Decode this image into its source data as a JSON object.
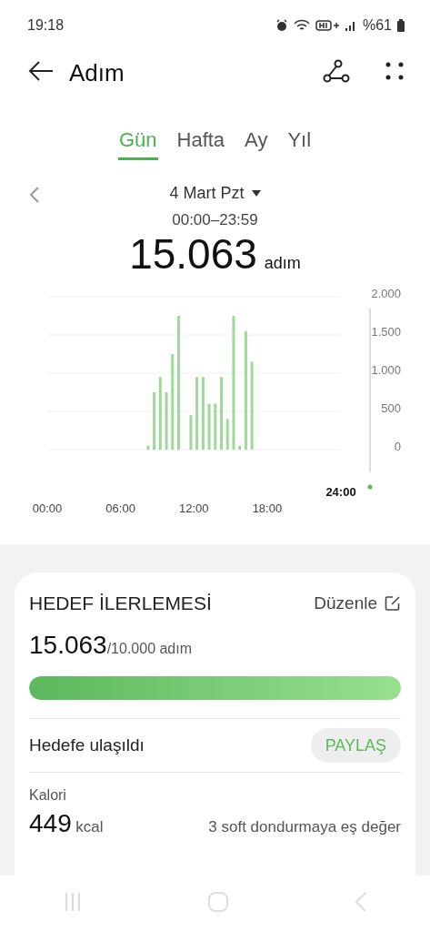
{
  "status_bar": {
    "time": "19:18",
    "battery": "%61"
  },
  "header": {
    "title": "Adım"
  },
  "tabs": [
    {
      "label": "Gün",
      "selected": true
    },
    {
      "label": "Hafta",
      "selected": false
    },
    {
      "label": "Ay",
      "selected": false
    },
    {
      "label": "Yıl",
      "selected": false
    }
  ],
  "date_nav": {
    "date": "4 Mart Pzt",
    "range": "00:00–23:59",
    "steps": "15.063",
    "unit": "adım"
  },
  "chart": {
    "marker_label": "24:00",
    "chart_data": {
      "type": "bar",
      "x": [
        8.25,
        8.75,
        9.25,
        9.75,
        10.25,
        10.75,
        11.25,
        11.75,
        12.25,
        12.75,
        13.25,
        13.75,
        14.25,
        14.75,
        15.25,
        15.75,
        16.25,
        16.75
      ],
      "values": [
        50,
        750,
        950,
        750,
        1250,
        1750,
        0,
        450,
        950,
        950,
        600,
        600,
        950,
        400,
        1750,
        50,
        1550,
        1150
      ],
      "xlim": [
        0,
        24
      ],
      "ylim": [
        0,
        2000
      ],
      "grid": true,
      "xticks": [
        {
          "value": 0,
          "label": "00:00"
        },
        {
          "value": 6,
          "label": "06:00"
        },
        {
          "value": 12,
          "label": "12:00"
        },
        {
          "value": 18,
          "label": "18:00"
        }
      ],
      "yticks": [
        {
          "value": 0,
          "label": "0"
        },
        {
          "value": 500,
          "label": "500"
        },
        {
          "value": 1000,
          "label": "1.000"
        },
        {
          "value": 1500,
          "label": "1.500"
        },
        {
          "value": 2000,
          "label": "2.000"
        }
      ]
    }
  },
  "goal": {
    "title": "HEDEF İLERLEMESİ",
    "edit": "Düzenle",
    "value": "15.063",
    "target": "/10.000 adım",
    "level": 1,
    "status": "Hedefe ulaşıldı",
    "share": "PAYLAŞ"
  },
  "calories": {
    "label": "Kalori",
    "value": "449",
    "unit": "kcal",
    "note": "3 soft dondurmaya eş değer"
  }
}
